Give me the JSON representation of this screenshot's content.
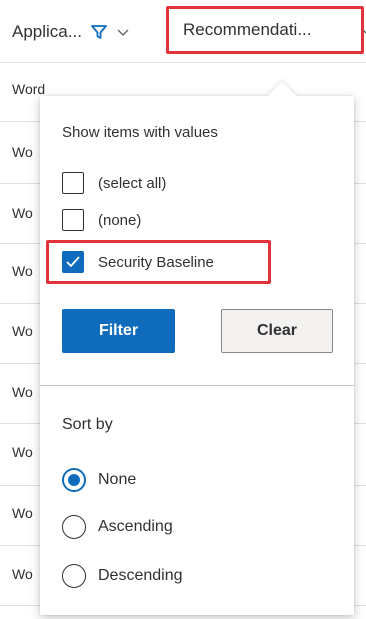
{
  "header": {
    "application_col_label": "Applica...",
    "recommendation_col_label": "Recommendati..."
  },
  "rows": [
    {
      "text": "Word"
    },
    {
      "text": "Wo"
    },
    {
      "text": "Wo"
    },
    {
      "text": "Wo"
    },
    {
      "text": "Wo"
    },
    {
      "text": "Wo"
    },
    {
      "text": "Wo"
    },
    {
      "text": "Wo"
    },
    {
      "text": "Wo"
    }
  ],
  "filter_panel": {
    "show_label": "Show items with values",
    "options": [
      {
        "label": "(select all)",
        "checked": false
      },
      {
        "label": "(none)",
        "checked": false
      },
      {
        "label": "Security Baseline",
        "checked": true
      }
    ],
    "filter_button": "Filter",
    "clear_button": "Clear",
    "sort_label": "Sort by",
    "sort_options": [
      {
        "label": "None",
        "selected": true
      },
      {
        "label": "Ascending",
        "selected": false
      },
      {
        "label": "Descending",
        "selected": false
      }
    ]
  },
  "colors": {
    "accent": "#0f6cbd",
    "highlight": "#e2333b"
  },
  "icons": {
    "filter": "filter-icon",
    "chevron": "chevron-down-icon",
    "check": "checkmark-icon"
  }
}
